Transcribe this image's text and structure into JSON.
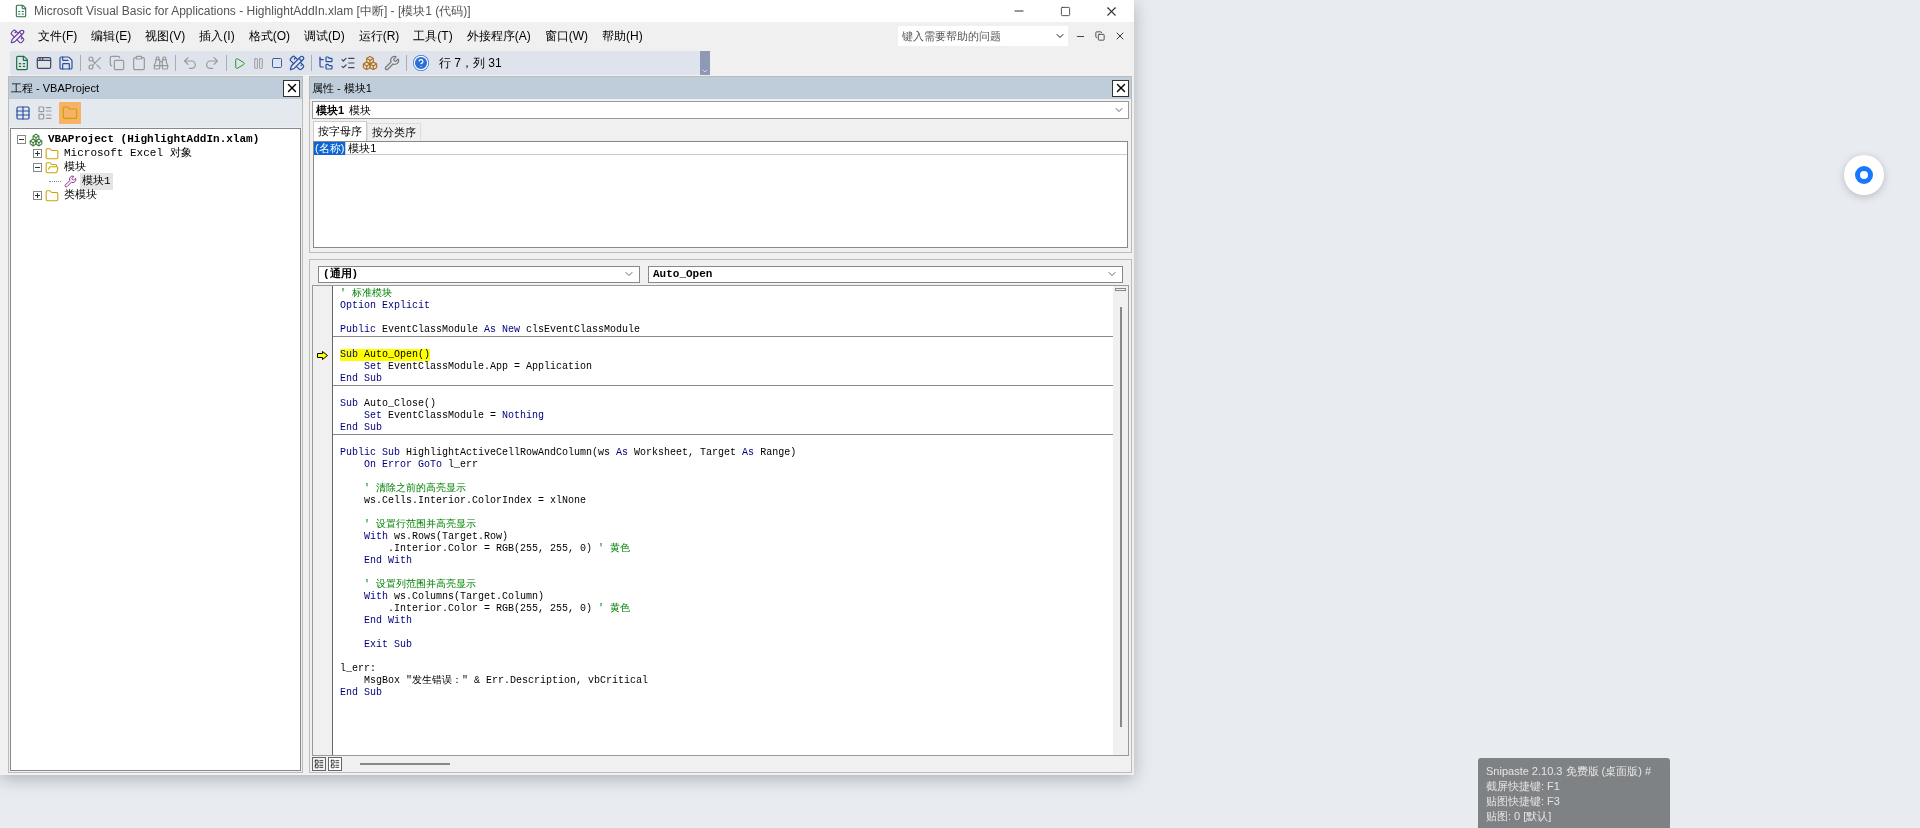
{
  "window": {
    "title": "Microsoft Visual Basic for Applications - HighlightAddIn.xlam [中断] - [模块1 (代码)]"
  },
  "menu": [
    "文件(F)",
    "编辑(E)",
    "视图(V)",
    "插入(I)",
    "格式(O)",
    "调试(D)",
    "运行(R)",
    "工具(T)",
    "外接程序(A)",
    "窗口(W)",
    "帮助(H)"
  ],
  "help_box": {
    "placeholder": "键入需要帮助的问题"
  },
  "toolbar": {
    "position": "行 7，列 31"
  },
  "project": {
    "title": "工程 - VBAProject",
    "tree": [
      {
        "label": "VBAProject (HighlightAddIn.xlam)",
        "kind": "project",
        "expanded": true,
        "selected": false,
        "children": [
          {
            "label": "Microsoft Excel 对象",
            "kind": "folder",
            "expanded": false,
            "selected": false
          },
          {
            "label": "模块",
            "kind": "folder",
            "expanded": true,
            "selected": false,
            "children": [
              {
                "label": "模块1",
                "kind": "module",
                "selected": true
              }
            ]
          },
          {
            "label": "类模块",
            "kind": "folder",
            "expanded": false,
            "selected": false
          }
        ]
      }
    ]
  },
  "properties": {
    "title": "属性 - 模块1",
    "object_name": "模块1",
    "object_type": "模块",
    "tabs": [
      {
        "label": "按字母序",
        "selected": true
      },
      {
        "label": "按分类序",
        "selected": false
      }
    ],
    "rows": [
      {
        "name": "(名称)",
        "value": "模块1",
        "selected": true
      }
    ]
  },
  "code": {
    "object": "(通用)",
    "procedure": "Auto_Open",
    "lines": [
      {
        "kind": "code",
        "current": false,
        "divider": false,
        "tokens": [
          {
            "kind": "comment",
            "text": "' 标准模块"
          }
        ]
      },
      {
        "kind": "code",
        "current": false,
        "divider": false,
        "tokens": [
          {
            "kind": "keyword",
            "text": "Option Explicit"
          }
        ]
      },
      {
        "kind": "blank",
        "current": false,
        "divider": false
      },
      {
        "kind": "code",
        "current": false,
        "divider": true,
        "tokens": [
          {
            "kind": "keyword",
            "text": "Public"
          },
          {
            "kind": "plain",
            "text": " EventClassModule "
          },
          {
            "kind": "keyword",
            "text": "As New"
          },
          {
            "kind": "plain",
            "text": " clsEventClassModule"
          }
        ]
      },
      {
        "kind": "blank",
        "current": false,
        "divider": false
      },
      {
        "kind": "code",
        "current": true,
        "divider": false,
        "tokens": [
          {
            "kind": "keyword",
            "text": "Sub"
          },
          {
            "kind": "plain",
            "text": " Auto_Open()"
          }
        ]
      },
      {
        "kind": "code",
        "current": false,
        "divider": false,
        "tokens": [
          {
            "kind": "keyword",
            "text": "    Set"
          },
          {
            "kind": "plain",
            "text": " EventClassModule.App = Application"
          }
        ]
      },
      {
        "kind": "code",
        "current": false,
        "divider": true,
        "tokens": [
          {
            "kind": "keyword",
            "text": "End Sub"
          }
        ]
      },
      {
        "kind": "blank",
        "current": false,
        "divider": false
      },
      {
        "kind": "code",
        "current": false,
        "divider": false,
        "tokens": [
          {
            "kind": "keyword",
            "text": "Sub"
          },
          {
            "kind": "plain",
            "text": " Auto_Close()"
          }
        ]
      },
      {
        "kind": "code",
        "current": false,
        "divider": false,
        "tokens": [
          {
            "kind": "keyword",
            "text": "    Set"
          },
          {
            "kind": "plain",
            "text": " EventClassModule = "
          },
          {
            "kind": "keyword",
            "text": "Nothing"
          }
        ]
      },
      {
        "kind": "code",
        "current": false,
        "divider": true,
        "tokens": [
          {
            "kind": "keyword",
            "text": "End Sub"
          }
        ]
      },
      {
        "kind": "blank",
        "current": false,
        "divider": false
      },
      {
        "kind": "code",
        "current": false,
        "divider": false,
        "tokens": [
          {
            "kind": "keyword",
            "text": "Public Sub"
          },
          {
            "kind": "plain",
            "text": " HighlightActiveCellRowAndColumn(ws "
          },
          {
            "kind": "keyword",
            "text": "As"
          },
          {
            "kind": "plain",
            "text": " Worksheet, Target "
          },
          {
            "kind": "keyword",
            "text": "As"
          },
          {
            "kind": "plain",
            "text": " Range)"
          }
        ]
      },
      {
        "kind": "code",
        "current": false,
        "divider": false,
        "tokens": [
          {
            "kind": "keyword",
            "text": "    On Error GoTo"
          },
          {
            "kind": "plain",
            "text": " l_err"
          }
        ]
      },
      {
        "kind": "blank",
        "current": false,
        "divider": false
      },
      {
        "kind": "code",
        "current": false,
        "divider": false,
        "tokens": [
          {
            "kind": "comment",
            "text": "    ' 清除之前的高亮显示"
          }
        ]
      },
      {
        "kind": "code",
        "current": false,
        "divider": false,
        "tokens": [
          {
            "kind": "plain",
            "text": "    ws.Cells.Interior.ColorIndex = xlNone"
          }
        ]
      },
      {
        "kind": "blank",
        "current": false,
        "divider": false
      },
      {
        "kind": "code",
        "current": false,
        "divider": false,
        "tokens": [
          {
            "kind": "comment",
            "text": "    ' 设置行范围并高亮显示"
          }
        ]
      },
      {
        "kind": "code",
        "current": false,
        "divider": false,
        "tokens": [
          {
            "kind": "keyword",
            "text": "    With"
          },
          {
            "kind": "plain",
            "text": " ws.Rows(Target.Row)"
          }
        ]
      },
      {
        "kind": "code",
        "current": false,
        "divider": false,
        "tokens": [
          {
            "kind": "plain",
            "text": "        .Interior.Color = RGB(255, 255, 0) "
          },
          {
            "kind": "comment",
            "text": "' 黄色"
          }
        ]
      },
      {
        "kind": "code",
        "current": false,
        "divider": false,
        "tokens": [
          {
            "kind": "keyword",
            "text": "    End With"
          }
        ]
      },
      {
        "kind": "blank",
        "current": false,
        "divider": false
      },
      {
        "kind": "code",
        "current": false,
        "divider": false,
        "tokens": [
          {
            "kind": "comment",
            "text": "    ' 设置列范围并高亮显示"
          }
        ]
      },
      {
        "kind": "code",
        "current": false,
        "divider": false,
        "tokens": [
          {
            "kind": "keyword",
            "text": "    With"
          },
          {
            "kind": "plain",
            "text": " ws.Columns(Target.Column)"
          }
        ]
      },
      {
        "kind": "code",
        "current": false,
        "divider": false,
        "tokens": [
          {
            "kind": "plain",
            "text": "        .Interior.Color = RGB(255, 255, 0) "
          },
          {
            "kind": "comment",
            "text": "' 黄色"
          }
        ]
      },
      {
        "kind": "code",
        "current": false,
        "divider": false,
        "tokens": [
          {
            "kind": "keyword",
            "text": "    End With"
          }
        ]
      },
      {
        "kind": "blank",
        "current": false,
        "divider": false
      },
      {
        "kind": "code",
        "current": false,
        "divider": false,
        "tokens": [
          {
            "kind": "keyword",
            "text": "    Exit Sub"
          }
        ]
      },
      {
        "kind": "blank",
        "current": false,
        "divider": false
      },
      {
        "kind": "code",
        "current": false,
        "divider": false,
        "tokens": [
          {
            "kind": "plain",
            "text": "l_err:"
          }
        ]
      },
      {
        "kind": "code",
        "current": false,
        "divider": false,
        "tokens": [
          {
            "kind": "plain",
            "text": "    MsgBox \"发生错误：\" & Err.Description, vbCritical"
          }
        ]
      },
      {
        "kind": "code",
        "current": false,
        "divider": false,
        "tokens": [
          {
            "kind": "keyword",
            "text": "End Sub"
          }
        ]
      }
    ]
  },
  "snipaste": {
    "lines": [
      "Snipaste 2.10.3 免费版 (桌面版) #",
      "截屏快捷键: F1",
      "贴图快捷键: F3",
      "贴图: 0 [默认]"
    ]
  }
}
